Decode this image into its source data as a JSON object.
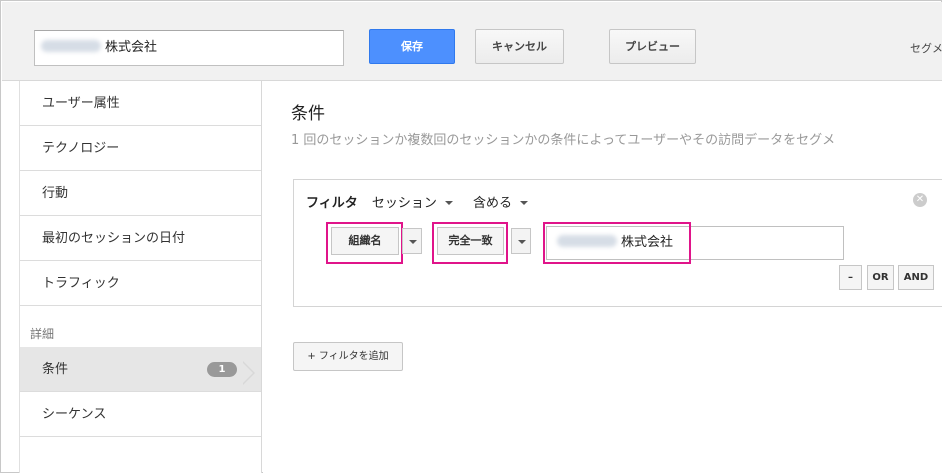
{
  "toolbar": {
    "segment_name_suffix": "株式会社",
    "save_label": "保存",
    "cancel_label": "キャンセル",
    "preview_label": "プレビュー",
    "segment_link": "セグメ"
  },
  "sidebar": {
    "items": [
      {
        "label": "ユーザー属性"
      },
      {
        "label": "テクノロジー"
      },
      {
        "label": "行動"
      },
      {
        "label": "最初のセッションの日付"
      },
      {
        "label": "トラフィック"
      }
    ],
    "detail_label": "詳細",
    "detail_items": [
      {
        "label": "条件",
        "badge": "1",
        "active": true
      },
      {
        "label": "シーケンス"
      }
    ]
  },
  "main": {
    "title": "条件",
    "description": "1 回のセッションか複数回のセッションかの条件によってユーザーやその訪問データをセグメ",
    "filter": {
      "label": "フィルタ",
      "scope": "セッション",
      "mode": "含める",
      "dimension": "組織名",
      "match_type": "完全一致",
      "value_suffix": "株式会社",
      "remove_label": "–",
      "or_label": "OR",
      "and_label": "AND"
    },
    "add_filter_label": "+ フィルタを追加"
  },
  "colors": {
    "accent_blue": "#4d90fe",
    "highlight_pink": "#e0148a",
    "badge_gray": "#999999"
  }
}
